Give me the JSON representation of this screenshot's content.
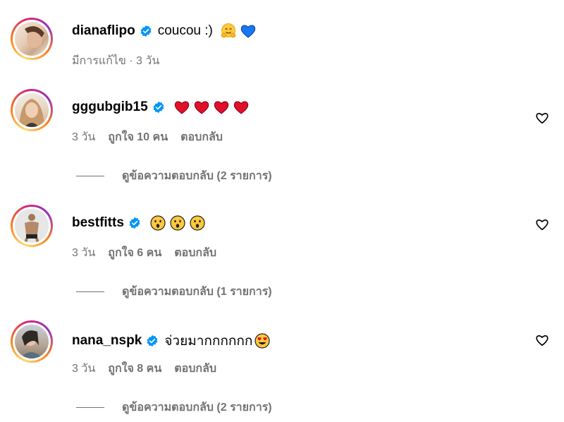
{
  "comments": [
    {
      "username": "dianaflipo",
      "text": "coucou :)",
      "emojis": [
        "hugging-face",
        "blue-heart"
      ],
      "meta": "มีการแก้ไข · 3 วัน",
      "time": "",
      "likes": "",
      "reply": "",
      "view_replies": ""
    },
    {
      "username": "gggubgib15",
      "text": "",
      "emojis": [
        "red-heart",
        "red-heart",
        "red-heart",
        "red-heart"
      ],
      "meta": "",
      "time": "3 วัน",
      "likes": "ถูกใจ 10 คน",
      "reply": "ตอบกลับ",
      "view_replies": "ดูข้อความตอบกลับ (2 รายการ)"
    },
    {
      "username": "bestfitts",
      "text": "",
      "emojis": [
        "hushed-face",
        "hushed-face",
        "hushed-face"
      ],
      "meta": "",
      "time": "3 วัน",
      "likes": "ถูกใจ 6 คน",
      "reply": "ตอบกลับ",
      "view_replies": "ดูข้อความตอบกลับ (1 รายการ)"
    },
    {
      "username": "nana_nspk",
      "text": "จ่วยมากกกกกก",
      "emojis": [
        "heart-eyes-face"
      ],
      "meta": "",
      "time": "3 วัน",
      "likes": "ถูกใจ 8 คน",
      "reply": "ตอบกลับ",
      "view_replies": "ดูข้อความตอบกลับ (2 รายการ)"
    }
  ],
  "colors": {
    "verified_blue": "#0095f6",
    "meta_gray": "#737373",
    "red_heart": "#e0102b",
    "blue_heart": "#1877f2",
    "emoji_yellow": "#ffc83d"
  }
}
